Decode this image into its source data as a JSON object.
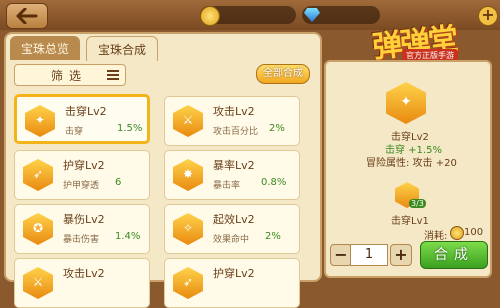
{
  "header": {
    "coin_amount": "",
    "gem_amount": ""
  },
  "logo": {
    "title": "弹弹堂",
    "subtitle": "官方正版手游"
  },
  "tabs": [
    {
      "label": "宝珠总览",
      "active": false
    },
    {
      "label": "宝珠合成",
      "active": true
    }
  ],
  "filter": {
    "label": "筛选"
  },
  "merge_all": {
    "label": "全部合成"
  },
  "cards": [
    {
      "name": "击穿Lv2",
      "stat": "击穿",
      "value": "1.5%",
      "selected": true
    },
    {
      "name": "攻击Lv2",
      "stat": "攻击百分比",
      "value": "2%"
    },
    {
      "name": "护穿Lv2",
      "stat": "护甲穿透",
      "value": "6"
    },
    {
      "name": "暴率Lv2",
      "stat": "暴击率",
      "value": "0.8%"
    },
    {
      "name": "暴伤Lv2",
      "stat": "暴击伤害",
      "value": "1.4%"
    },
    {
      "name": "起效Lv2",
      "stat": "效果命中",
      "value": "2%"
    },
    {
      "name": "攻击Lv2",
      "stat": "",
      "value": ""
    },
    {
      "name": "护穿Lv2",
      "stat": "",
      "value": ""
    }
  ],
  "detail": {
    "result_name": "击穿Lv2",
    "result_stat": "击穿 +1.5%",
    "adventure_attr": "冒险属性: 攻击 +20",
    "source_name": "击穿Lv1",
    "source_count": "3/3",
    "cost_label": "消耗:",
    "cost_value": "100"
  },
  "stepper": {
    "minus": "−",
    "plus": "+",
    "quantity": "1"
  },
  "merge_button": {
    "label": "合成"
  },
  "colors": {
    "accent_gold": "#f2b418",
    "positive_green": "#3a8a20"
  }
}
